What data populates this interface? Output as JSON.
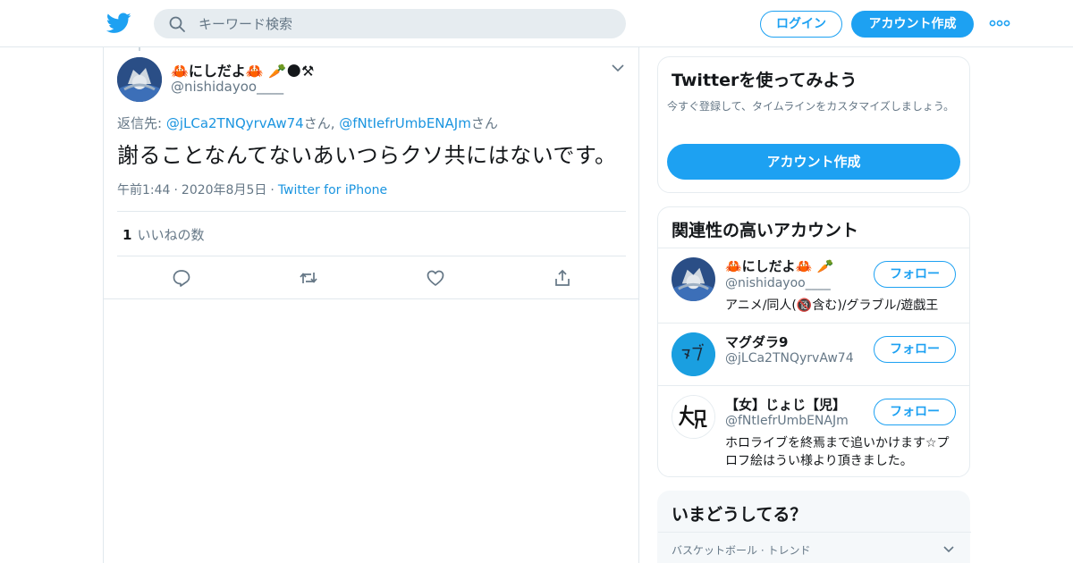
{
  "header": {
    "search_placeholder": "キーワード検索",
    "login_label": "ログイン",
    "signup_label": "アカウント作成"
  },
  "tweet": {
    "author_name": "🦀にしだよ🦀 🥕🌑⚒",
    "author_handle": "@nishidayoo____",
    "reply_prefix": "返信先: ",
    "reply_to_1": "@jLCa2TNQyrvAw74",
    "reply_suffix_1": "さん, ",
    "reply_to_2": "@fNtIefrUmbENAJm",
    "reply_suffix_2": "さん",
    "text": "謝ることなんてないあいつらクソ共にはないです。",
    "time": "午前1:44",
    "date": "2020年8月5日",
    "source": "Twitter for iPhone",
    "dot": "·",
    "likes_count": "1",
    "likes_label": "いいねの数"
  },
  "sidebar": {
    "signup_card": {
      "title": "Twitterを使ってみよう",
      "description": "今すぐ登録して、タイムラインをカスタマイズしましょう。",
      "cta": "アカウント作成"
    },
    "related": {
      "title": "関連性の高いアカウント",
      "follow_label": "フォロー",
      "accounts": [
        {
          "name": "🦀にしだよ🦀 🥕",
          "handle": "@nishidayoo____",
          "bio": "アニメ/同人(🔞含む)/グラブル/遊戯王"
        },
        {
          "name": "マグダラ9",
          "handle": "@jLCa2TNQyrvAw74",
          "bio": ""
        },
        {
          "name": "【女】じょじ【児】",
          "handle": "@fNtIefrUmbENAJm",
          "bio": "ホロライブを終焉まで追いかけます☆プロフ絵はうい様より頂きました。"
        }
      ]
    },
    "trends": {
      "title": "いまどうしてる？",
      "first_trend_meta": "バスケットボール · トレンド"
    }
  },
  "colors": {
    "accent": "#1da1f2",
    "link": "#1b95e0",
    "muted": "#657786",
    "border": "#e1e8ed"
  }
}
